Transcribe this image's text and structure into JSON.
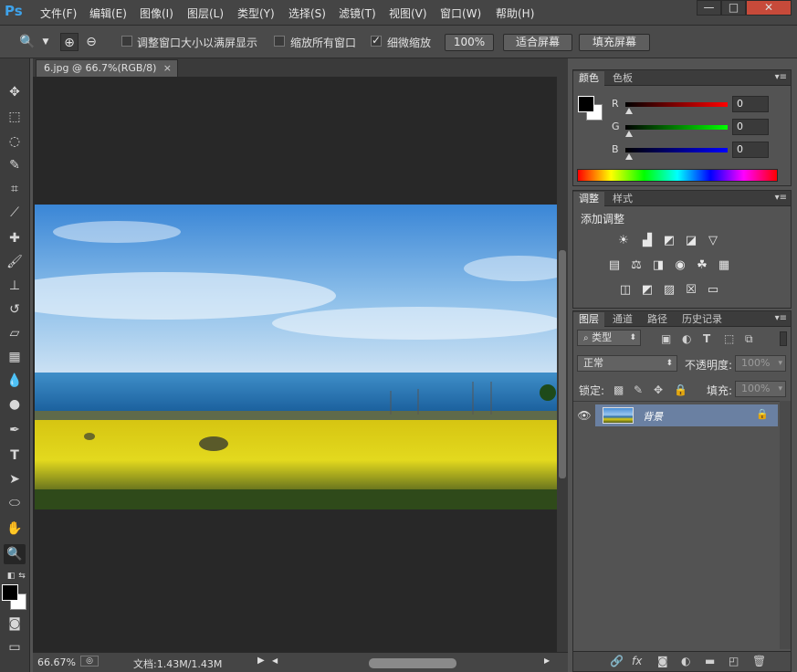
{
  "app": {
    "logo": "Ps"
  },
  "menu": [
    "文件(F)",
    "编辑(E)",
    "图像(I)",
    "图层(L)",
    "类型(Y)",
    "选择(S)",
    "滤镜(T)",
    "视图(V)",
    "窗口(W)",
    "帮助(H)"
  ],
  "window_buttons": [
    "—",
    "□",
    "✕"
  ],
  "options": {
    "resize_windows": "调整窗口大小以满屏显示",
    "zoom_all": "缩放所有窗口",
    "scrubby_zoom": "细微缩放",
    "btn_100": "100%",
    "btn_fit": "适合屏幕",
    "btn_fill": "填充屏幕"
  },
  "document": {
    "tab_title": "6.jpg @ 66.7%(RGB/8)",
    "close": "×"
  },
  "status": {
    "zoom": "66.67%",
    "doc_info": "文档:1.43M/1.43M"
  },
  "color_panel": {
    "tabs": [
      "颜色",
      "色板"
    ],
    "channels": [
      {
        "label": "R",
        "value": "0",
        "color": "#ff0000"
      },
      {
        "label": "G",
        "value": "0",
        "color": "#00ff00"
      },
      {
        "label": "B",
        "value": "0",
        "color": "#0000ff"
      }
    ]
  },
  "adjust_panel": {
    "tabs": [
      "调整",
      "样式"
    ],
    "title": "添加调整"
  },
  "layers_panel": {
    "tabs": [
      "图层",
      "通道",
      "路径",
      "历史记录"
    ],
    "filter_kind": "类型",
    "blend_mode": "正常",
    "opacity_label": "不透明度:",
    "opacity_value": "100%",
    "lock_label": "锁定:",
    "fill_label": "填充:",
    "fill_value": "100%",
    "layers": [
      {
        "name": "背景",
        "visible": true,
        "locked": true
      }
    ]
  },
  "colors": {
    "accent": "#3ea2ea",
    "selected_layer": "#6a80a2",
    "panel_bg": "#535353",
    "canvas_bg": "#282828"
  }
}
